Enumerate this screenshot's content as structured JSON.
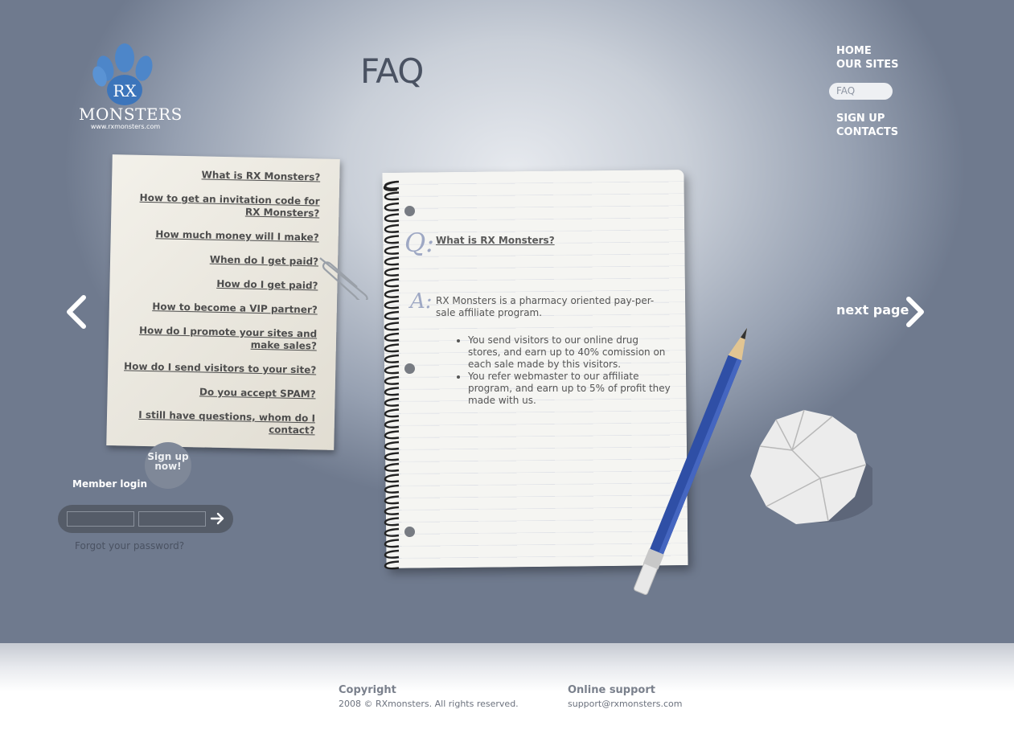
{
  "logo": {
    "word": "MONSTERS",
    "url": "www.rxmonsters.com",
    "mark": "RX"
  },
  "page_title": "FAQ",
  "nav": {
    "home": "HOME",
    "our_sites": "OUR SITES",
    "faq": "FAQ",
    "sign_up": "SIGN UP",
    "contacts": "CONTACTS"
  },
  "questions": [
    "What is RX Monsters?",
    "How to get an invitation code for RX Monsters?",
    "How much money will I make?",
    "When do I get paid?",
    "How do I get paid?",
    "How to become a VIP partner?",
    "How do I promote your sites and make sales?",
    "How do I send visitors to your site?",
    "Do you accept SPAM?",
    "I still have questions, whom do I contact?"
  ],
  "answer": {
    "question": "What is RX Monsters?",
    "text": "RX Monsters is a pharmacy oriented pay-per-sale affiliate program.",
    "bullets": [
      "You send visitors to our online drug stores, and earn up to 40% comission on each sale made by this visitors.",
      "You refer webmaster to our affiliate program, and earn up to 5% of profit they made with us."
    ],
    "q_mark": "Q:",
    "a_mark": "A:"
  },
  "next_page": "next page",
  "login": {
    "label": "Member login",
    "signup_bubble": "Sign up now!",
    "forgot": "Forgot your password?"
  },
  "footer": {
    "copyright_heading": "Copyright",
    "copyright_text": "2008 © RXmonsters. All rights reserved.",
    "support_heading": "Online support",
    "support_email": "support@rxmonsters.com"
  }
}
